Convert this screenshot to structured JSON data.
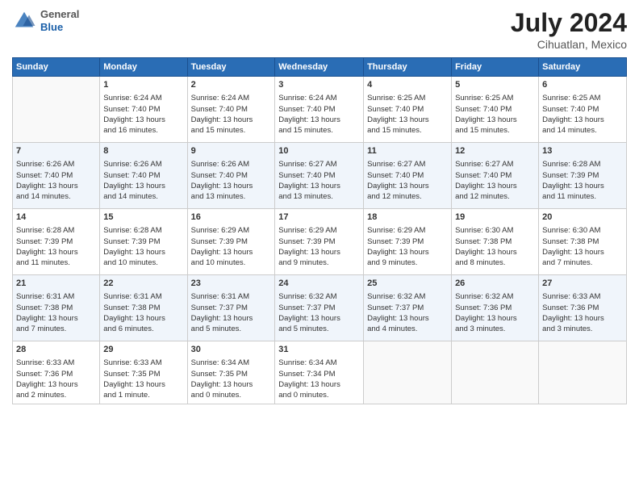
{
  "header": {
    "logo_line1": "General",
    "logo_line2": "Blue",
    "month_year": "July 2024",
    "location": "Cihuatlan, Mexico"
  },
  "days_of_week": [
    "Sunday",
    "Monday",
    "Tuesday",
    "Wednesday",
    "Thursday",
    "Friday",
    "Saturday"
  ],
  "weeks": [
    [
      {
        "day": "",
        "data": ""
      },
      {
        "day": "1",
        "data": "Sunrise: 6:24 AM\nSunset: 7:40 PM\nDaylight: 13 hours\nand 16 minutes."
      },
      {
        "day": "2",
        "data": "Sunrise: 6:24 AM\nSunset: 7:40 PM\nDaylight: 13 hours\nand 15 minutes."
      },
      {
        "day": "3",
        "data": "Sunrise: 6:24 AM\nSunset: 7:40 PM\nDaylight: 13 hours\nand 15 minutes."
      },
      {
        "day": "4",
        "data": "Sunrise: 6:25 AM\nSunset: 7:40 PM\nDaylight: 13 hours\nand 15 minutes."
      },
      {
        "day": "5",
        "data": "Sunrise: 6:25 AM\nSunset: 7:40 PM\nDaylight: 13 hours\nand 15 minutes."
      },
      {
        "day": "6",
        "data": "Sunrise: 6:25 AM\nSunset: 7:40 PM\nDaylight: 13 hours\nand 14 minutes."
      }
    ],
    [
      {
        "day": "7",
        "data": "Sunrise: 6:26 AM\nSunset: 7:40 PM\nDaylight: 13 hours\nand 14 minutes."
      },
      {
        "day": "8",
        "data": "Sunrise: 6:26 AM\nSunset: 7:40 PM\nDaylight: 13 hours\nand 14 minutes."
      },
      {
        "day": "9",
        "data": "Sunrise: 6:26 AM\nSunset: 7:40 PM\nDaylight: 13 hours\nand 13 minutes."
      },
      {
        "day": "10",
        "data": "Sunrise: 6:27 AM\nSunset: 7:40 PM\nDaylight: 13 hours\nand 13 minutes."
      },
      {
        "day": "11",
        "data": "Sunrise: 6:27 AM\nSunset: 7:40 PM\nDaylight: 13 hours\nand 12 minutes."
      },
      {
        "day": "12",
        "data": "Sunrise: 6:27 AM\nSunset: 7:40 PM\nDaylight: 13 hours\nand 12 minutes."
      },
      {
        "day": "13",
        "data": "Sunrise: 6:28 AM\nSunset: 7:39 PM\nDaylight: 13 hours\nand 11 minutes."
      }
    ],
    [
      {
        "day": "14",
        "data": "Sunrise: 6:28 AM\nSunset: 7:39 PM\nDaylight: 13 hours\nand 11 minutes."
      },
      {
        "day": "15",
        "data": "Sunrise: 6:28 AM\nSunset: 7:39 PM\nDaylight: 13 hours\nand 10 minutes."
      },
      {
        "day": "16",
        "data": "Sunrise: 6:29 AM\nSunset: 7:39 PM\nDaylight: 13 hours\nand 10 minutes."
      },
      {
        "day": "17",
        "data": "Sunrise: 6:29 AM\nSunset: 7:39 PM\nDaylight: 13 hours\nand 9 minutes."
      },
      {
        "day": "18",
        "data": "Sunrise: 6:29 AM\nSunset: 7:39 PM\nDaylight: 13 hours\nand 9 minutes."
      },
      {
        "day": "19",
        "data": "Sunrise: 6:30 AM\nSunset: 7:38 PM\nDaylight: 13 hours\nand 8 minutes."
      },
      {
        "day": "20",
        "data": "Sunrise: 6:30 AM\nSunset: 7:38 PM\nDaylight: 13 hours\nand 7 minutes."
      }
    ],
    [
      {
        "day": "21",
        "data": "Sunrise: 6:31 AM\nSunset: 7:38 PM\nDaylight: 13 hours\nand 7 minutes."
      },
      {
        "day": "22",
        "data": "Sunrise: 6:31 AM\nSunset: 7:38 PM\nDaylight: 13 hours\nand 6 minutes."
      },
      {
        "day": "23",
        "data": "Sunrise: 6:31 AM\nSunset: 7:37 PM\nDaylight: 13 hours\nand 5 minutes."
      },
      {
        "day": "24",
        "data": "Sunrise: 6:32 AM\nSunset: 7:37 PM\nDaylight: 13 hours\nand 5 minutes."
      },
      {
        "day": "25",
        "data": "Sunrise: 6:32 AM\nSunset: 7:37 PM\nDaylight: 13 hours\nand 4 minutes."
      },
      {
        "day": "26",
        "data": "Sunrise: 6:32 AM\nSunset: 7:36 PM\nDaylight: 13 hours\nand 3 minutes."
      },
      {
        "day": "27",
        "data": "Sunrise: 6:33 AM\nSunset: 7:36 PM\nDaylight: 13 hours\nand 3 minutes."
      }
    ],
    [
      {
        "day": "28",
        "data": "Sunrise: 6:33 AM\nSunset: 7:36 PM\nDaylight: 13 hours\nand 2 minutes."
      },
      {
        "day": "29",
        "data": "Sunrise: 6:33 AM\nSunset: 7:35 PM\nDaylight: 13 hours\nand 1 minute."
      },
      {
        "day": "30",
        "data": "Sunrise: 6:34 AM\nSunset: 7:35 PM\nDaylight: 13 hours\nand 0 minutes."
      },
      {
        "day": "31",
        "data": "Sunrise: 6:34 AM\nSunset: 7:34 PM\nDaylight: 13 hours\nand 0 minutes."
      },
      {
        "day": "",
        "data": ""
      },
      {
        "day": "",
        "data": ""
      },
      {
        "day": "",
        "data": ""
      }
    ]
  ]
}
